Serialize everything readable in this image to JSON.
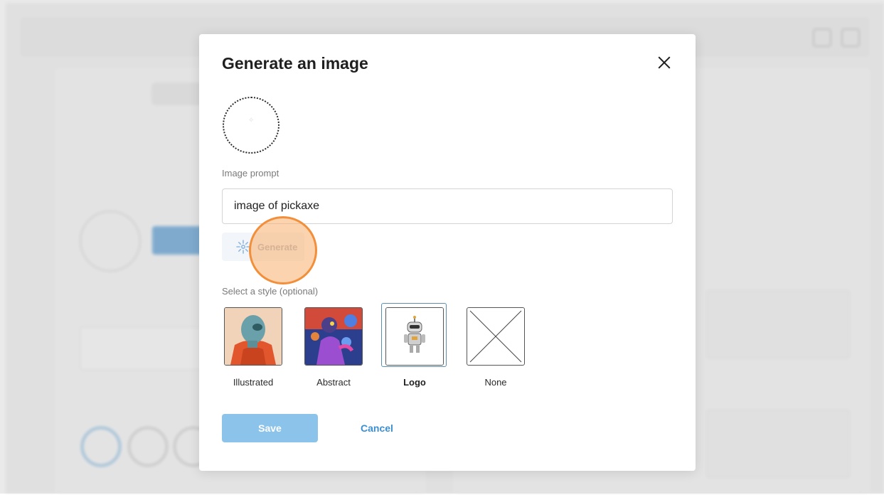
{
  "modal": {
    "title": "Generate an image",
    "close_icon": "close-icon",
    "image_prompt_label": "Image prompt",
    "image_prompt_value": "image of pickaxe",
    "generate_label": "Generate",
    "generate_icon": "sparkle-icon",
    "style_label": "Select a style (optional)",
    "styles": [
      {
        "label": "Illustrated",
        "selected": false
      },
      {
        "label": "Abstract",
        "selected": false
      },
      {
        "label": "Logo",
        "selected": true
      },
      {
        "label": "None",
        "selected": false
      }
    ],
    "save_label": "Save",
    "cancel_label": "Cancel"
  },
  "colors": {
    "accent": "#3b8fd1",
    "save_disabled": "#8cc3ea",
    "highlight": "#f28f3b"
  }
}
